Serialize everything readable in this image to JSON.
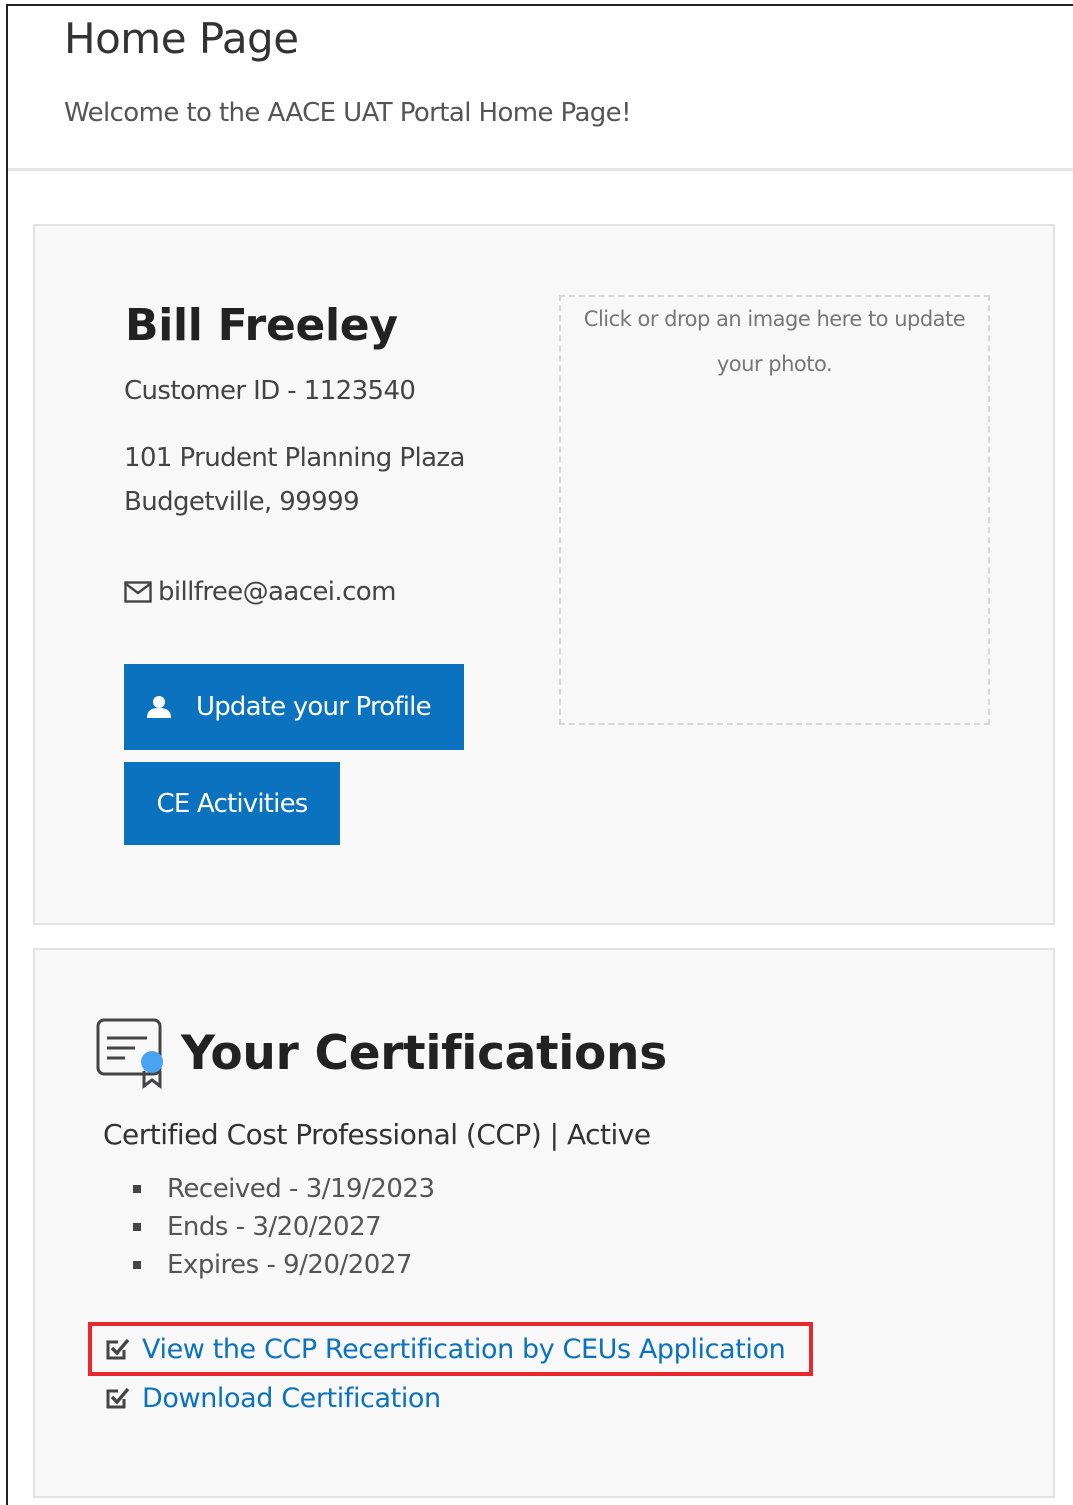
{
  "header": {
    "title": "Home Page",
    "welcome": "Welcome to the AACE UAT Portal Home Page!"
  },
  "profile": {
    "name": "Bill Freeley",
    "customer_id": "Customer ID - 1123540",
    "address_line1": "101 Prudent Planning Plaza",
    "address_line2": "Budgetville, 99999",
    "email": "billfree@aacei.com",
    "update_profile_label": "Update your Profile",
    "ce_activities_label": "CE Activities",
    "photo_dropzone_text": "Click or drop an image here to update your photo."
  },
  "certifications": {
    "heading": "Your Certifications",
    "items": [
      {
        "title": "Certified Cost Professional (CCP) | Active",
        "details": [
          "Received - 3/19/2023",
          "Ends - 3/20/2027",
          "Expires - 9/20/2027"
        ]
      }
    ],
    "links": [
      {
        "label": "View the CCP Recertification by CEUs Application",
        "icon": "check-square-icon",
        "highlighted": true
      },
      {
        "label": "Download Certification",
        "icon": "check-square-icon",
        "highlighted": false
      }
    ]
  },
  "colors": {
    "primary": "#0b72c0",
    "highlight": "#e8282c",
    "badge_accent": "#4aa3f0"
  }
}
